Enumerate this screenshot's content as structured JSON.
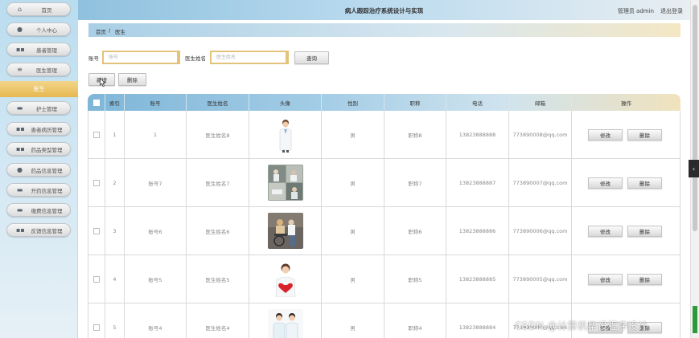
{
  "header": {
    "title": "病人跟踪治疗系统设计与实现",
    "user": "管理员 admin",
    "logout": "退出登录"
  },
  "sidebar": {
    "items": [
      {
        "label": "首页",
        "icon": "home-icon"
      },
      {
        "label": "个人中心",
        "icon": "user-icon"
      },
      {
        "label": "患者管理",
        "icon": "grid-icon"
      },
      {
        "label": "医生管理",
        "icon": "list-icon"
      },
      {
        "label": "护士管理",
        "icon": "card-icon"
      },
      {
        "label": "患者病历管理",
        "icon": "grid-icon"
      },
      {
        "label": "药品类型管理",
        "icon": "grid-icon"
      },
      {
        "label": "药品信息管理",
        "icon": "user-icon"
      },
      {
        "label": "开药信息管理",
        "icon": "card-icon"
      },
      {
        "label": "缴费信息管理",
        "icon": "card-icon"
      },
      {
        "label": "反馈信息管理",
        "icon": "grid-icon"
      }
    ],
    "active": "医生"
  },
  "breadcrumb": {
    "home": "首页",
    "sep": "/",
    "current": "医生"
  },
  "search": {
    "account_label": "账号",
    "account_placeholder": "账号",
    "name_label": "医生姓名",
    "name_placeholder": "医生姓名",
    "query_button": "查询"
  },
  "actions": {
    "add": "新增",
    "delete": "删除"
  },
  "table": {
    "headers": [
      "",
      "索引",
      "账号",
      "医生姓名",
      "头像",
      "性别",
      "职称",
      "电话",
      "邮箱",
      "操作"
    ],
    "rows": [
      {
        "index": "1",
        "account": "1",
        "name": "医生姓名8",
        "gender": "男",
        "title": "职称8",
        "phone": "13823888888",
        "email": "773890008@qq.com",
        "avatar": "doctor-single"
      },
      {
        "index": "2",
        "account": "账号7",
        "name": "医生姓名7",
        "gender": "男",
        "title": "职称7",
        "phone": "13823888887",
        "email": "773890007@qq.com",
        "avatar": "ward-collage"
      },
      {
        "index": "3",
        "account": "账号6",
        "name": "医生姓名6",
        "gender": "男",
        "title": "职称6",
        "phone": "13823888886",
        "email": "773890006@qq.com",
        "avatar": "patient-wheelchair"
      },
      {
        "index": "4",
        "account": "账号5",
        "name": "医生姓名5",
        "gender": "男",
        "title": "职称5",
        "phone": "13823888885",
        "email": "773890005@qq.com",
        "avatar": "doctor-heart"
      },
      {
        "index": "5",
        "account": "账号4",
        "name": "医生姓名4",
        "gender": "男",
        "title": "职称4",
        "phone": "13823888884",
        "email": "773890004@qq.com",
        "avatar": "nurses-pair"
      }
    ],
    "edit_label": "修改",
    "delete_label": "删除"
  },
  "watermark": "CSDN @计算机毕设程序设计"
}
